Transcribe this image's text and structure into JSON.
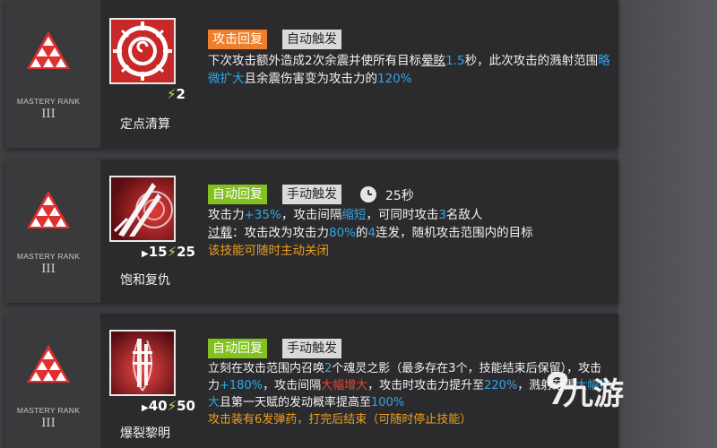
{
  "mastery": {
    "label": "MASTERY RANK",
    "rank": "III"
  },
  "skills": [
    {
      "name": "定点清算",
      "cost": "2",
      "tags": {
        "recovery": "攻击回复",
        "trigger": "自动触发"
      },
      "desc": {
        "a": "下次攻击额外造成2次余震并使所有目标",
        "b": "晕眩",
        "c": "1.5",
        "d": "秒，此次攻击的溅射范围",
        "e": "略微扩大",
        "f": "且余震伤害变为攻击力的",
        "g": "120%"
      }
    },
    {
      "name": "饱和复仇",
      "init": "15",
      "cost": "25",
      "tags": {
        "recovery": "自动回复",
        "trigger": "手动触发",
        "duration": "25秒"
      },
      "desc": {
        "a": "攻击力",
        "b": "+35%",
        "c": "，攻击间隔",
        "d": "缩短",
        "e": "，可同时攻击",
        "f": "3",
        "g": "名敌人",
        "h": "过载",
        "i": "：攻击改为攻击力",
        "j": "80%",
        "k": "的",
        "l": "4",
        "m": "连发，随机攻击范围内的目标",
        "n": "该技能可随时主动关闭"
      }
    },
    {
      "name": "爆裂黎明",
      "init": "40",
      "cost": "50",
      "tags": {
        "recovery": "自动回复",
        "trigger": "手动触发"
      },
      "desc": {
        "a": "立刻在攻击范围内召唤",
        "b": "2",
        "c": "个魂灵之影（最多存在3个，技能结束后保留），攻击力",
        "d": "+180%",
        "e": "，攻击间隔",
        "f": "大幅增大",
        "g": "，攻击时攻击力提升至",
        "h": "220%",
        "i": "，溅射范围",
        "j": "大幅扩大",
        "k": "且第一天赋的发动概率提高至",
        "l": "100%",
        "m": "攻击装有6发弹药，打完后结束（可随时停止技能）"
      }
    }
  ],
  "watermark": {
    "text": "九游"
  },
  "colors": {
    "blue": "#2fa7e8",
    "orange": "#ee9f1e",
    "red": "#e6452f",
    "green_tag": "#82c21e",
    "orange_tag": "#f07f2a",
    "sp_bolt": "#b7e34a"
  },
  "icons": [
    "triangle-rank-icon",
    "lightning-bolt-icon",
    "play-arrow-icon",
    "clock-icon"
  ]
}
